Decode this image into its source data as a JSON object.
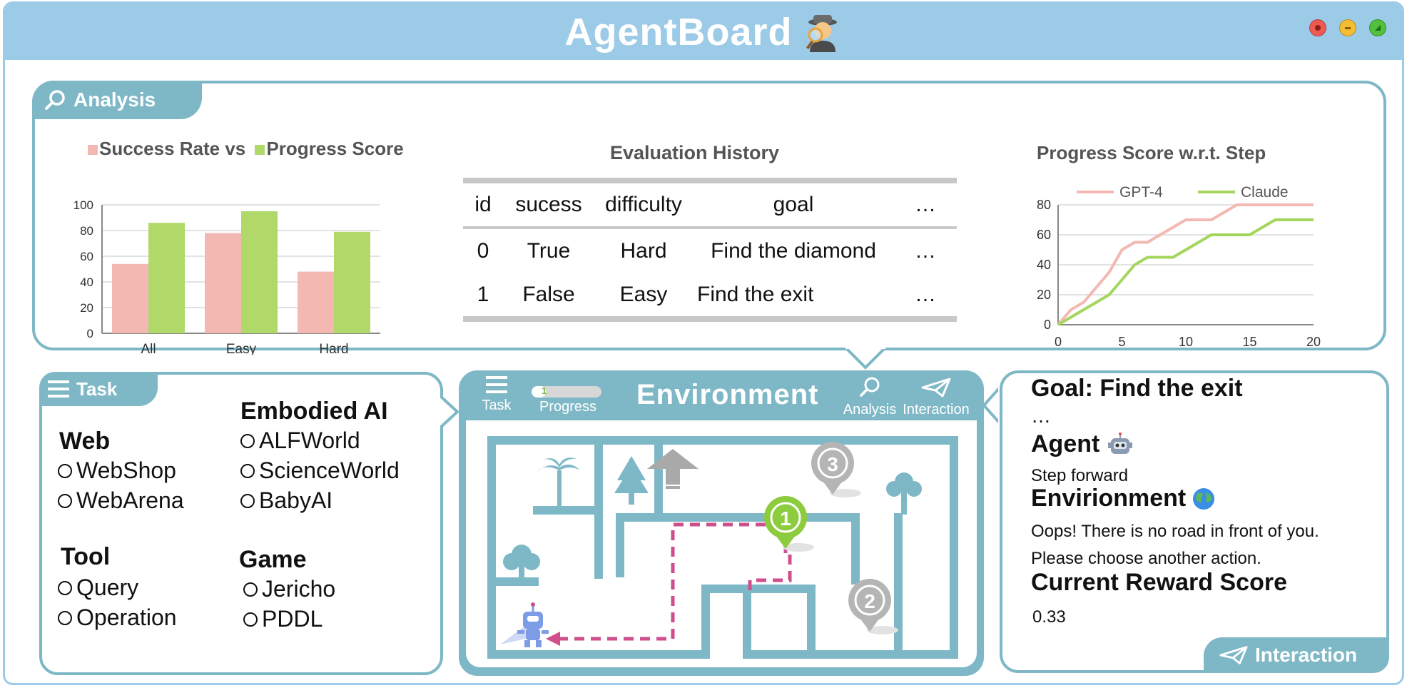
{
  "window": {
    "title": "AgentBoard",
    "title_icon": "detective-icon",
    "buttons": [
      "close-button",
      "minimize-button",
      "maximize-button"
    ],
    "colors": {
      "frame": "#9ccbe8",
      "panel": "#7eb8c6",
      "bar_success": "#f4b8b3",
      "bar_progress": "#b0d96a",
      "gpt4": "#f4b8b3",
      "claude": "#a4d65e",
      "path": "#cf4f8c",
      "marker_active": "#8ccc3e",
      "marker_inactive": "#b5b5b5"
    }
  },
  "analysis": {
    "tab_label": "Analysis",
    "bar_chart": {
      "type": "bar",
      "title_part1": "Success Rate vs ",
      "title_part2": "Progress Score",
      "categories": [
        "All",
        "Easy",
        "Hard"
      ],
      "series": [
        {
          "name": "Success Rate",
          "values": [
            54,
            78,
            48
          ]
        },
        {
          "name": "Progress Score",
          "values": [
            86,
            95,
            79
          ]
        }
      ],
      "ylim": [
        0,
        100
      ],
      "yticks": [
        "0",
        "20",
        "40",
        "60",
        "80",
        "100"
      ],
      "grid": true
    },
    "eval_history": {
      "title": "Evaluation History",
      "columns": [
        "id",
        "sucess",
        "difficulty",
        "goal",
        "…"
      ],
      "rows": [
        [
          "0",
          "True",
          "Hard",
          "Find the diamond",
          "…"
        ],
        [
          "1",
          "False",
          "Easy",
          "Find the exit",
          "…"
        ]
      ]
    },
    "line_chart": {
      "type": "line",
      "title": "Progress Score w.r.t. Step",
      "legend": [
        "GPT-4",
        "Claude"
      ],
      "legend_placement": "top",
      "xlim": [
        0,
        20
      ],
      "ylim": [
        0,
        80
      ],
      "xticks": [
        "0",
        "5",
        "10",
        "15",
        "20"
      ],
      "yticks": [
        "0",
        "20",
        "40",
        "60",
        "80"
      ],
      "series": [
        {
          "name": "GPT-4",
          "x": [
            0,
            1,
            2,
            3,
            4,
            5,
            6,
            7,
            8,
            9,
            10,
            11,
            12,
            13,
            14,
            15,
            16,
            17,
            18,
            19,
            20
          ],
          "y": [
            0,
            10,
            15,
            25,
            35,
            50,
            55,
            55,
            60,
            65,
            70,
            70,
            70,
            75,
            80,
            80,
            80,
            80,
            80,
            80,
            80
          ]
        },
        {
          "name": "Claude",
          "x": [
            0,
            1,
            2,
            3,
            4,
            5,
            6,
            7,
            8,
            9,
            10,
            11,
            12,
            13,
            14,
            15,
            16,
            17,
            18,
            19,
            20
          ],
          "y": [
            0,
            5,
            10,
            15,
            20,
            30,
            40,
            45,
            45,
            45,
            50,
            55,
            60,
            60,
            60,
            60,
            65,
            70,
            70,
            70,
            70
          ]
        }
      ]
    }
  },
  "chart_data": [
    {
      "type": "bar",
      "title": "Success Rate vs Progress Score",
      "categories": [
        "All",
        "Easy",
        "Hard"
      ],
      "series": [
        {
          "name": "Success Rate",
          "values": [
            54,
            78,
            48
          ]
        },
        {
          "name": "Progress Score",
          "values": [
            86,
            95,
            79
          ]
        }
      ],
      "ylim": [
        0,
        100
      ]
    },
    {
      "type": "line",
      "title": "Progress Score w.r.t. Step",
      "xlim": [
        0,
        20
      ],
      "ylim": [
        0,
        80
      ],
      "series": [
        {
          "name": "GPT-4",
          "x": [
            0,
            1,
            2,
            3,
            4,
            5,
            6,
            7,
            8,
            9,
            10,
            11,
            12,
            13,
            14,
            15,
            16,
            17,
            18,
            19,
            20
          ],
          "y": [
            0,
            10,
            15,
            25,
            35,
            50,
            55,
            55,
            60,
            65,
            70,
            70,
            70,
            75,
            80,
            80,
            80,
            80,
            80,
            80,
            80
          ]
        },
        {
          "name": "Claude",
          "x": [
            0,
            1,
            2,
            3,
            4,
            5,
            6,
            7,
            8,
            9,
            10,
            11,
            12,
            13,
            14,
            15,
            16,
            17,
            18,
            19,
            20
          ],
          "y": [
            0,
            5,
            10,
            15,
            20,
            30,
            40,
            45,
            45,
            45,
            50,
            55,
            60,
            60,
            60,
            60,
            65,
            70,
            70,
            70,
            70
          ]
        }
      ]
    }
  ],
  "task": {
    "tab_label": "Task",
    "groups": [
      {
        "title": "Web",
        "options": [
          "WebShop",
          "WebArena"
        ]
      },
      {
        "title": "Embodied AI",
        "options": [
          "ALFWorld",
          "ScienceWorld",
          "BabyAI"
        ]
      },
      {
        "title": "Tool",
        "options": [
          "Query",
          "Operation"
        ]
      },
      {
        "title": "Game",
        "options": [
          "Jericho",
          "PDDL"
        ]
      }
    ]
  },
  "environment": {
    "title": "Environment",
    "task_label": "Task",
    "progress_label": "Progress",
    "progress_value": "1",
    "progress_fraction": 0.2,
    "analysis_label": "Analysis",
    "interaction_label": "Interaction",
    "markers": [
      "1",
      "2",
      "3"
    ]
  },
  "interaction": {
    "goal": "Goal: Find the exit",
    "ellipsis": "…",
    "agent_heading": "Agent",
    "agent_icon": "robot-icon",
    "agent_action": "Step forward",
    "env_heading": "Envirionment",
    "env_icon": "globe-icon",
    "env_message_1": "Oops! There is no road in front of you.",
    "env_message_2": "Please choose another action.",
    "reward_heading": "Current Reward Score",
    "reward_value": "0.33",
    "tab_label": "Interaction"
  }
}
